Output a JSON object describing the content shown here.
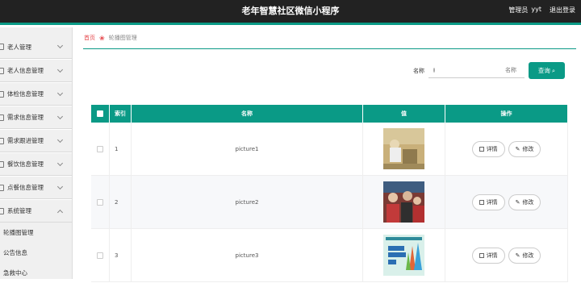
{
  "header": {
    "title": "老年智慧社区微信小程序",
    "role": "管理员",
    "username": "yyt",
    "logout": "退出登录"
  },
  "sidebar": {
    "items": [
      {
        "label": "老人管理"
      },
      {
        "label": "老人信息管理"
      },
      {
        "label": "体检信息管理"
      },
      {
        "label": "需求信息管理"
      },
      {
        "label": "需求跟进管理"
      },
      {
        "label": "餐饮信息管理"
      },
      {
        "label": "点餐信息管理"
      },
      {
        "label": "系统管理"
      }
    ],
    "sub_items": [
      {
        "label": "轮播图管理"
      },
      {
        "label": "公告信息"
      },
      {
        "label": "急救中心"
      }
    ]
  },
  "breadcrumb": {
    "home": "首页",
    "current": "轮播图管理"
  },
  "search": {
    "label": "名称",
    "placeholder": "名称",
    "button": "查询"
  },
  "table": {
    "headers": {
      "index": "索引",
      "name": "名称",
      "value": "值",
      "ops": "操作"
    },
    "rows": [
      {
        "index": "1",
        "name": "picture1"
      },
      {
        "index": "2",
        "name": "picture2"
      },
      {
        "index": "3",
        "name": "picture3"
      }
    ],
    "detail_label": "详情",
    "edit_label": "修改"
  },
  "colors": {
    "accent": "#0a9a86",
    "topbar": "#222222",
    "breadcrumb_home": "#e5464a"
  }
}
